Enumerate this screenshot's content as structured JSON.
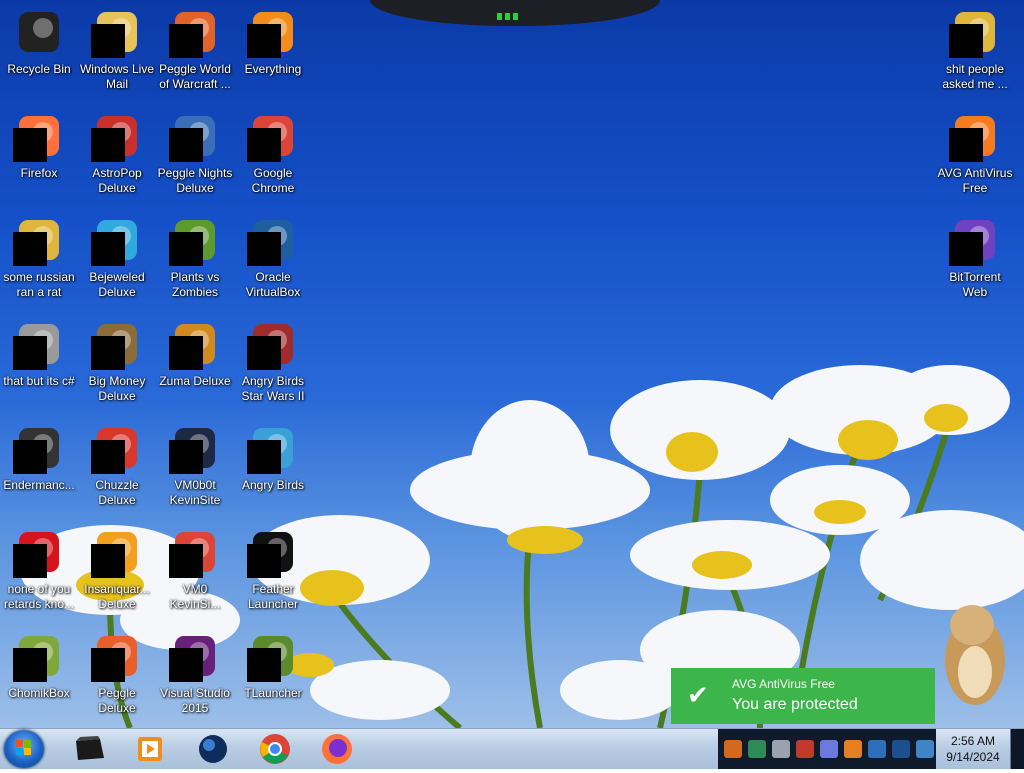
{
  "desktop": {
    "icons": [
      {
        "label": "Recycle Bin",
        "icon": "recycle-bin-icon"
      },
      {
        "label": "Windows Live Mail",
        "icon": "mail-icon"
      },
      {
        "label": "Peggle World of Warcraft ...",
        "icon": "peggle-wow-icon"
      },
      {
        "label": "Everything",
        "icon": "search-everything-icon"
      },
      {
        "label": "Firefox",
        "icon": "firefox-icon"
      },
      {
        "label": "AstroPop Deluxe",
        "icon": "astropop-icon"
      },
      {
        "label": "Peggle Nights Deluxe",
        "icon": "peggle-nights-icon"
      },
      {
        "label": "Google Chrome",
        "icon": "chrome-icon"
      },
      {
        "label": "some russian ran a rat",
        "icon": "folder-icon"
      },
      {
        "label": "Bejeweled Deluxe",
        "icon": "bejeweled-icon"
      },
      {
        "label": "Plants vs Zombies",
        "icon": "pvz-icon"
      },
      {
        "label": "Oracle VirtualBox",
        "icon": "virtualbox-icon"
      },
      {
        "label": "that but its c#",
        "icon": "stack-icon"
      },
      {
        "label": "Big Money Deluxe",
        "icon": "big-money-icon"
      },
      {
        "label": "Zuma Deluxe",
        "icon": "zuma-icon"
      },
      {
        "label": "Angry Birds Star Wars II",
        "icon": "angry-birds-sw-icon"
      },
      {
        "label": "Endermanc...",
        "icon": "terminal-icon"
      },
      {
        "label": "Chuzzle Deluxe",
        "icon": "chuzzle-icon"
      },
      {
        "label": "VM0b0t KevinSite",
        "icon": "vm-icon"
      },
      {
        "label": "Angry Birds",
        "icon": "angry-birds-icon"
      },
      {
        "label": "none of you retards kno...",
        "icon": "opera-icon"
      },
      {
        "label": "Insaniquar... Deluxe",
        "icon": "insaniquarium-icon"
      },
      {
        "label": "VM0 KevinSi...",
        "icon": "chrome-icon"
      },
      {
        "label": "Feather Launcher",
        "icon": "feather-icon"
      },
      {
        "label": "ChomikBox",
        "icon": "chomikbox-icon"
      },
      {
        "label": "Peggle Deluxe",
        "icon": "peggle-icon"
      },
      {
        "label": "Visual Studio 2015",
        "icon": "visual-studio-icon"
      },
      {
        "label": "TLauncher",
        "icon": "minecraft-grass-icon"
      },
      {
        "label": "shit people asked me ...",
        "icon": "folder-icon"
      },
      {
        "label": "AVG AntiVirus Free",
        "icon": "avg-icon"
      },
      {
        "label": "BitTorrent Web",
        "icon": "bittorrent-icon"
      }
    ]
  },
  "toast": {
    "app": "AVG AntiVirus Free",
    "message": "You are protected",
    "icon": "checkmark-icon"
  },
  "taskbar": {
    "start": "windows-start-icon",
    "pinned": [
      "black-box-icon",
      "media-player-icon",
      "globe-icon",
      "chrome-icon",
      "firefox-icon"
    ],
    "tray": [
      "tray-app-1",
      "tray-app-2",
      "tray-app-3",
      "tray-app-4",
      "tray-app-5",
      "tray-app-6",
      "tray-app-7",
      "tray-app-8",
      "tray-app-9"
    ]
  },
  "clock": {
    "time": "2:56 AM",
    "date": "9/14/2024"
  },
  "colors": {
    "toast": "#3cb54a",
    "taskbar": "#b9cde3",
    "tray": "#0f1b2b",
    "sky": "#1550c8"
  }
}
